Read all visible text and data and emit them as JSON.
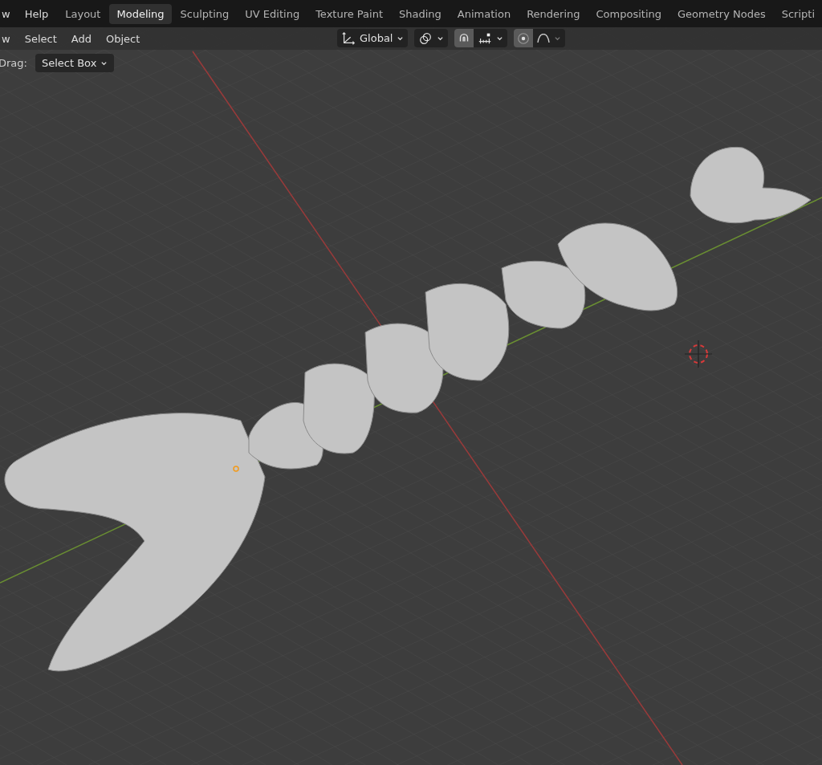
{
  "top_menu": [
    {
      "label": "w"
    },
    {
      "label": "Help"
    }
  ],
  "workspaces": [
    {
      "label": "Layout",
      "selected": false
    },
    {
      "label": "Modeling",
      "selected": true
    },
    {
      "label": "Sculpting",
      "selected": false
    },
    {
      "label": "UV Editing",
      "selected": false
    },
    {
      "label": "Texture Paint",
      "selected": false
    },
    {
      "label": "Shading",
      "selected": false
    },
    {
      "label": "Animation",
      "selected": false
    },
    {
      "label": "Rendering",
      "selected": false
    },
    {
      "label": "Compositing",
      "selected": false
    },
    {
      "label": "Geometry Nodes",
      "selected": false
    },
    {
      "label": "Scripti",
      "selected": false
    }
  ],
  "header_menu": [
    {
      "label": "w"
    },
    {
      "label": "Select"
    },
    {
      "label": "Add"
    },
    {
      "label": "Object"
    }
  ],
  "transform_orientation": {
    "label": "Global"
  },
  "snapping": {
    "on": true
  },
  "proportional_editing": {
    "on": true
  },
  "tool_settings": {
    "label": "Drag:",
    "value": "Select Box"
  }
}
